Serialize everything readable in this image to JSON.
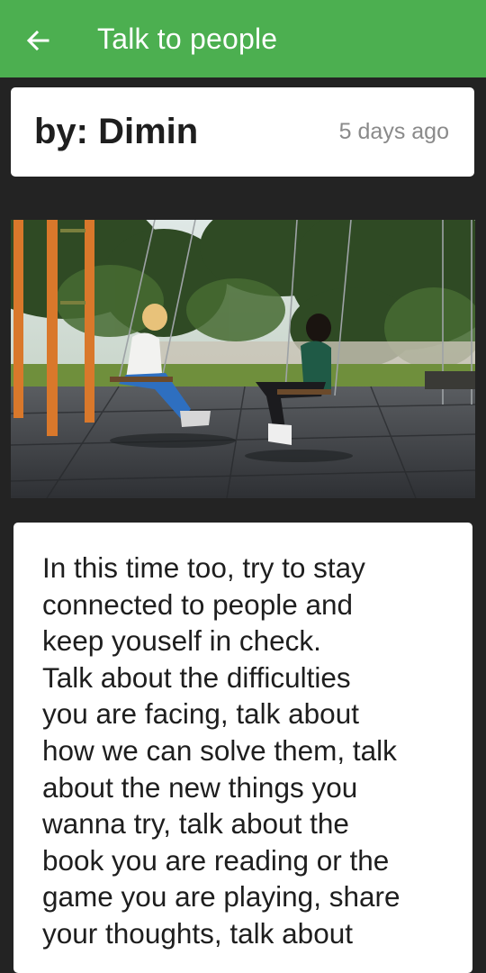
{
  "appbar": {
    "title": "Talk to people",
    "back_icon": "arrow-left-icon",
    "color": "#4caf50"
  },
  "post": {
    "author": "by: Dimin",
    "time": "5 days ago",
    "image_icon": "photo-two-women-on-swings",
    "body": "In this time too, try to stay\nconnected to people and\nkeep youself in check.\nTalk about the difficulties\nyou are facing, talk about\nhow we can solve them, talk\nabout the new things you\nwanna try, talk about the\nbook you are reading or the\ngame you are playing, share\nyour thoughts, talk about"
  },
  "colors": {
    "background": "#232323",
    "card": "#ffffff",
    "timestamp": "#8a8a8a"
  }
}
